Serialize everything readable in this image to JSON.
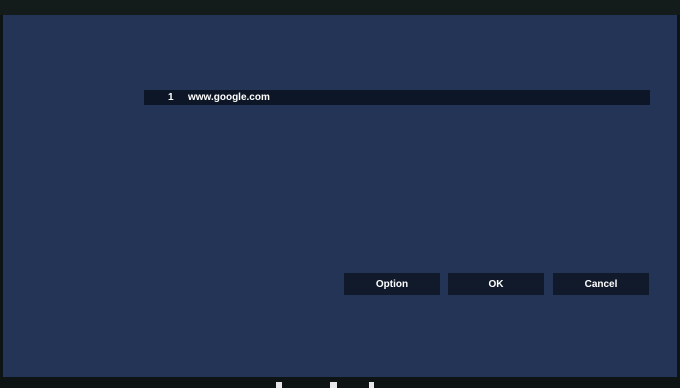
{
  "url_list": {
    "items": [
      {
        "index": "1",
        "url": "www.google.com"
      }
    ]
  },
  "buttons": {
    "option_label": "Option",
    "ok_label": "OK",
    "cancel_label": "Cancel"
  },
  "colors": {
    "dialog_background": "#233457",
    "list_row_background": "#0d1626",
    "button_background": "#111a2b",
    "frame": "#0e1414",
    "text": "#ffffff"
  }
}
